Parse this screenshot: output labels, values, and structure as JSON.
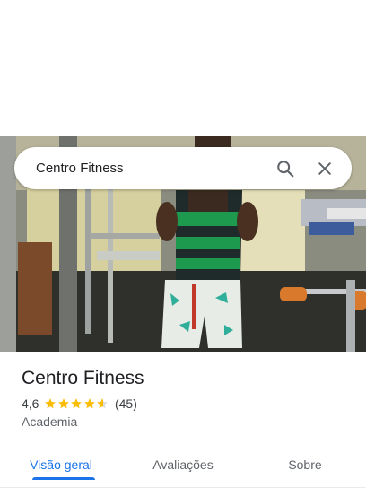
{
  "search": {
    "query": "Centro Fitness"
  },
  "place": {
    "name": "Centro Fitness",
    "rating": "4,6",
    "rating_value": 4.6,
    "reviews_count": "(45)",
    "category": "Academia"
  },
  "tabs": [
    {
      "label": "Visão geral",
      "active": true
    },
    {
      "label": "Avaliações",
      "active": false
    },
    {
      "label": "Sobre",
      "active": false
    }
  ],
  "colors": {
    "accent": "#1a73e8",
    "star": "#fbbc04",
    "star_empty": "#dadce0"
  },
  "icons": [
    "search-icon",
    "close-icon",
    "star-icon"
  ]
}
